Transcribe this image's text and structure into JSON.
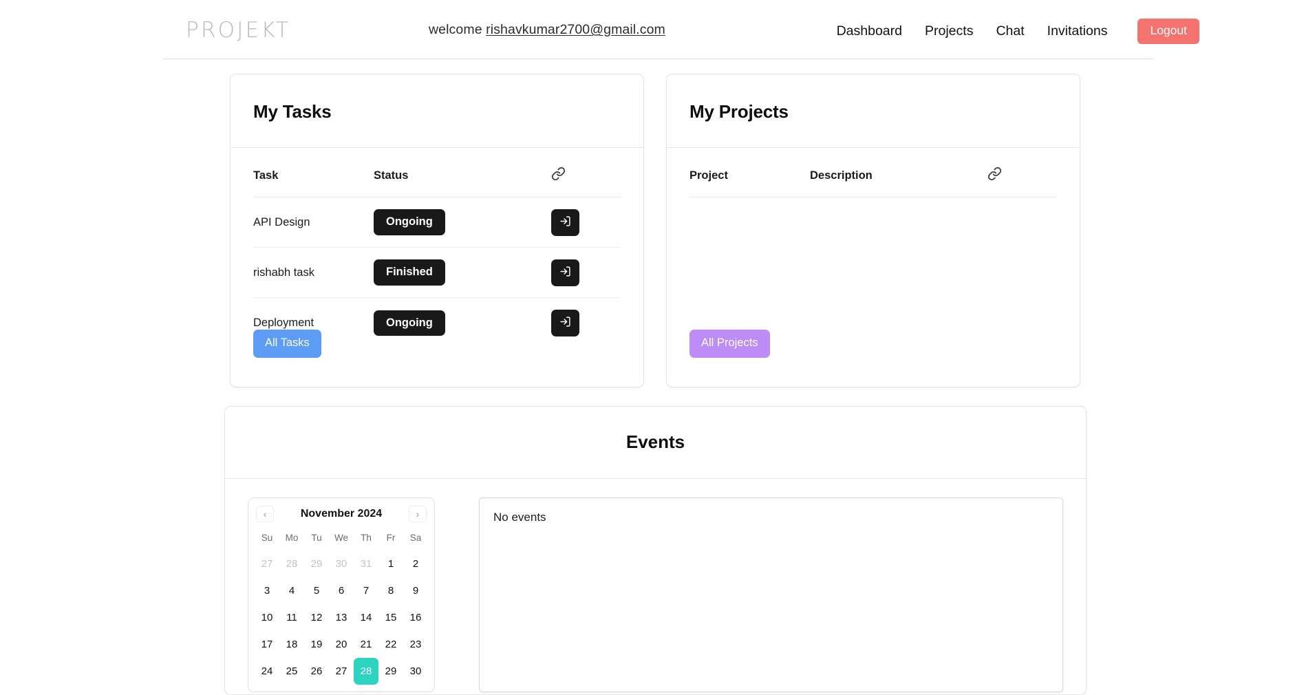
{
  "navbar": {
    "brand": "PROJEKT",
    "welcome_prefix": "welcome ",
    "user_email": "rishavkumar2700@gmail.com",
    "links": [
      {
        "label": "Dashboard"
      },
      {
        "label": "Projects"
      },
      {
        "label": "Chat"
      },
      {
        "label": "Invitations"
      }
    ],
    "logout_label": "Logout",
    "logout_color": "#f5736f"
  },
  "tasks_card": {
    "title": "My Tasks",
    "columns": [
      "Task",
      "Status",
      "link-icon"
    ],
    "rows": [
      {
        "task": "API Design",
        "status": "Ongoing",
        "action": "open-icon"
      },
      {
        "task": "rishabh task",
        "status": "Finished",
        "action": "open-icon"
      },
      {
        "task": "Deployment",
        "status": "Ongoing",
        "action": "open-icon"
      }
    ],
    "button_label": "All Tasks",
    "button_color": "#5d9cf5"
  },
  "projects_card": {
    "title": "My Projects",
    "columns": [
      "Project",
      "Description",
      "link-icon"
    ],
    "rows": [],
    "button_label": "All Projects",
    "button_color": "#bd8cf7"
  },
  "events_card": {
    "title": "Events",
    "calendar": {
      "month_label": "November 2024",
      "prev_icon": "chevron-left-icon",
      "next_icon": "chevron-right-icon",
      "weekdays": [
        "Su",
        "Mo",
        "Tu",
        "We",
        "Th",
        "Fr",
        "Sa"
      ],
      "selected_day": 28,
      "selected_color": "#2bd3c0",
      "days": [
        {
          "n": "27",
          "muted": true
        },
        {
          "n": "28",
          "muted": true
        },
        {
          "n": "29",
          "muted": true
        },
        {
          "n": "30",
          "muted": true
        },
        {
          "n": "31",
          "muted": true
        },
        {
          "n": "1",
          "muted": false
        },
        {
          "n": "2",
          "muted": false
        },
        {
          "n": "3",
          "muted": false
        },
        {
          "n": "4",
          "muted": false
        },
        {
          "n": "5",
          "muted": false
        },
        {
          "n": "6",
          "muted": false
        },
        {
          "n": "7",
          "muted": false
        },
        {
          "n": "8",
          "muted": false
        },
        {
          "n": "9",
          "muted": false
        },
        {
          "n": "10",
          "muted": false
        },
        {
          "n": "11",
          "muted": false
        },
        {
          "n": "12",
          "muted": false
        },
        {
          "n": "13",
          "muted": false
        },
        {
          "n": "14",
          "muted": false
        },
        {
          "n": "15",
          "muted": false
        },
        {
          "n": "16",
          "muted": false
        },
        {
          "n": "17",
          "muted": false
        },
        {
          "n": "18",
          "muted": false
        },
        {
          "n": "19",
          "muted": false
        },
        {
          "n": "20",
          "muted": false
        },
        {
          "n": "21",
          "muted": false
        },
        {
          "n": "22",
          "muted": false
        },
        {
          "n": "23",
          "muted": false
        },
        {
          "n": "24",
          "muted": false
        },
        {
          "n": "25",
          "muted": false
        },
        {
          "n": "26",
          "muted": false
        },
        {
          "n": "27",
          "muted": false
        },
        {
          "n": "28",
          "muted": false,
          "selected": true
        },
        {
          "n": "29",
          "muted": false
        },
        {
          "n": "30",
          "muted": false
        }
      ]
    },
    "empty_message": "No events"
  }
}
